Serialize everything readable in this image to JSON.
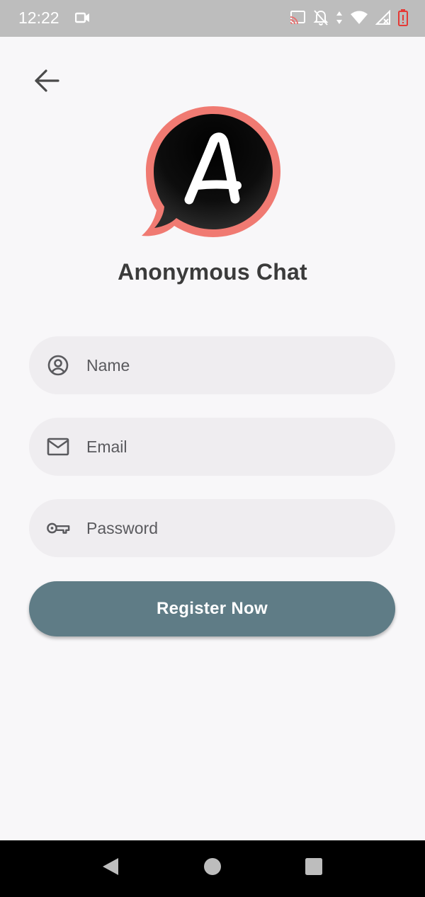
{
  "status_bar": {
    "time": "12:22",
    "icons": [
      "video-camera-icon",
      "cast-icon",
      "notifications-off-icon",
      "data-arrows-icon",
      "wifi-icon",
      "signal-no-service-icon",
      "battery-alert-icon"
    ]
  },
  "header": {
    "back_icon": "arrow-back-icon"
  },
  "logo": {
    "letter": "A",
    "ring_color": "#f07a72",
    "bubble_color": "#111111"
  },
  "app_title": "Anonymous Chat",
  "form": {
    "name": {
      "placeholder": "Name",
      "value": "",
      "icon": "account-circle-icon"
    },
    "email": {
      "placeholder": "Email",
      "value": "",
      "icon": "mail-icon"
    },
    "password": {
      "placeholder": "Password",
      "value": "",
      "icon": "key-icon"
    }
  },
  "register_button": {
    "label": "Register Now",
    "color": "#5f7c86"
  },
  "nav_bar": {
    "items": [
      "nav-back-icon",
      "nav-home-icon",
      "nav-recents-icon"
    ]
  },
  "colors": {
    "background": "#f8f7f9",
    "field_background": "#efedf0",
    "status_bar": "#bdbdbd"
  }
}
